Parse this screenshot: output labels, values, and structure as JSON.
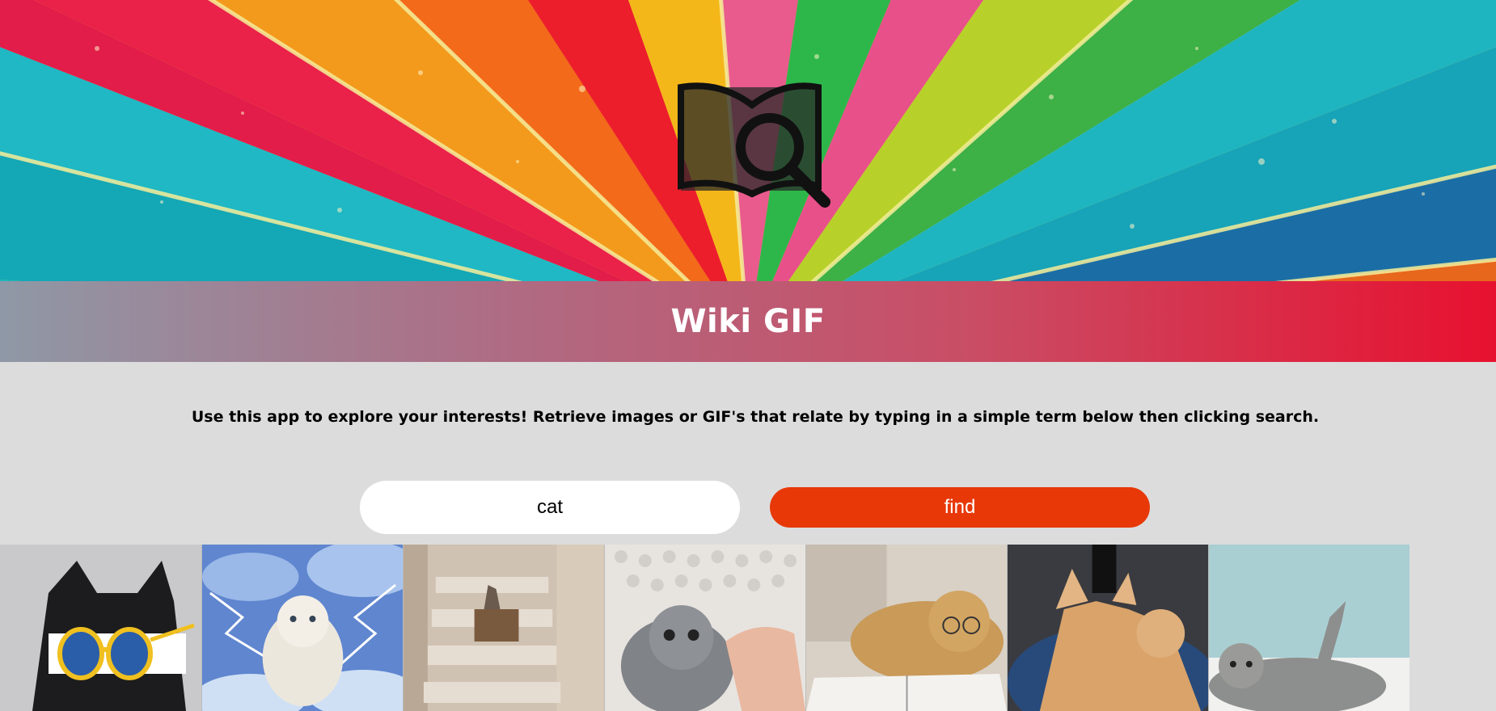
{
  "header": {
    "title": "Wiki GIF"
  },
  "intro": {
    "text": "Use this app to explore your interests! Retrieve images or GIF's that relate by typing in a simple term below then clicking search."
  },
  "search": {
    "value": "cat",
    "button_label": "find"
  },
  "logo": {
    "icon": "book-magnifier-icon"
  },
  "results": [
    {
      "name": "cat-sunglasses-gif"
    },
    {
      "name": "cat-lightning-gif"
    },
    {
      "name": "cat-box-stairs-gif"
    },
    {
      "name": "kitten-hand-gif"
    },
    {
      "name": "cat-glasses-book-gif"
    },
    {
      "name": "cat-jumping-gif"
    },
    {
      "name": "cat-stretching-gif"
    }
  ],
  "colors": {
    "button": "#e83808",
    "page_bg": "#dcdcdc",
    "title_end": "#e7112f",
    "title_start": "#8f98a6"
  }
}
